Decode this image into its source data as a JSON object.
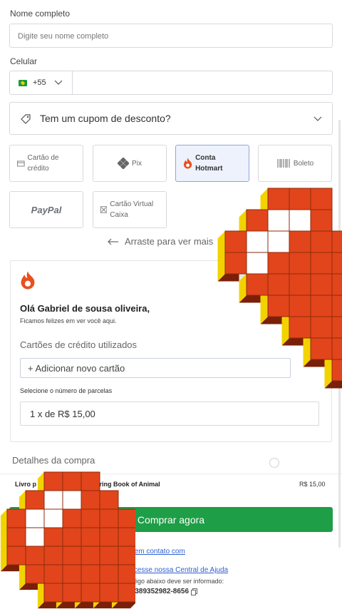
{
  "form": {
    "name_label": "Nome completo",
    "name_placeholder": "Digite seu nome completo",
    "phone_label": "Celular",
    "phone_prefix": "+55",
    "flag_icon": "brazil-flag-icon"
  },
  "coupon": {
    "label": "Tem um cupom de desconto?"
  },
  "payment_methods": [
    {
      "label": "Cartão de crédito",
      "icon": "credit-card-icon",
      "selected": false
    },
    {
      "label": "Pix",
      "icon": "pix-icon",
      "selected": false
    },
    {
      "label": "Conta Hotmart",
      "icon": "hotmart-flame-icon",
      "selected": true
    },
    {
      "label": "Boleto",
      "icon": "barcode-icon",
      "selected": false
    },
    {
      "label": "PayPal",
      "icon": "paypal-logo",
      "selected": false
    },
    {
      "label": "Cartão Virtual Caixa",
      "icon": "caixa-card-icon",
      "selected": false
    }
  ],
  "swipe_hint": "Arraste para ver mais",
  "hotmart_panel": {
    "partial_text": "ga",
    "greeting": "Olá Gabriel de sousa oliveira,",
    "subgreeting": "Ficamos felizes em ver você aqui.",
    "used_cards_title": "Cartões de crédito utilizados",
    "add_card": "+ Adicionar novo cartão",
    "installments_label": "Selecione o número de parcelas",
    "installments_value": "1 x de R$ 15,00"
  },
  "purchase": {
    "title": "Detalhes da compra",
    "item_left": "Livro p",
    "item_right": "oloring Book of Animal",
    "price": "R$ 15,00",
    "buy_button": "Comprar agora"
  },
  "footer": {
    "contact_link": "re em contato com",
    "help_link": "ompra? Acesse nossa Central de Ajuda",
    "info_text": "amento, o código abaixo deve ser informado:",
    "code": "28tq9o1-1762389352982-8656"
  },
  "colors": {
    "accent_green": "#1e9e46",
    "hotmart_orange": "#e8501e",
    "selected_border": "#8fa5e0",
    "link_blue": "#2f5fd0"
  }
}
